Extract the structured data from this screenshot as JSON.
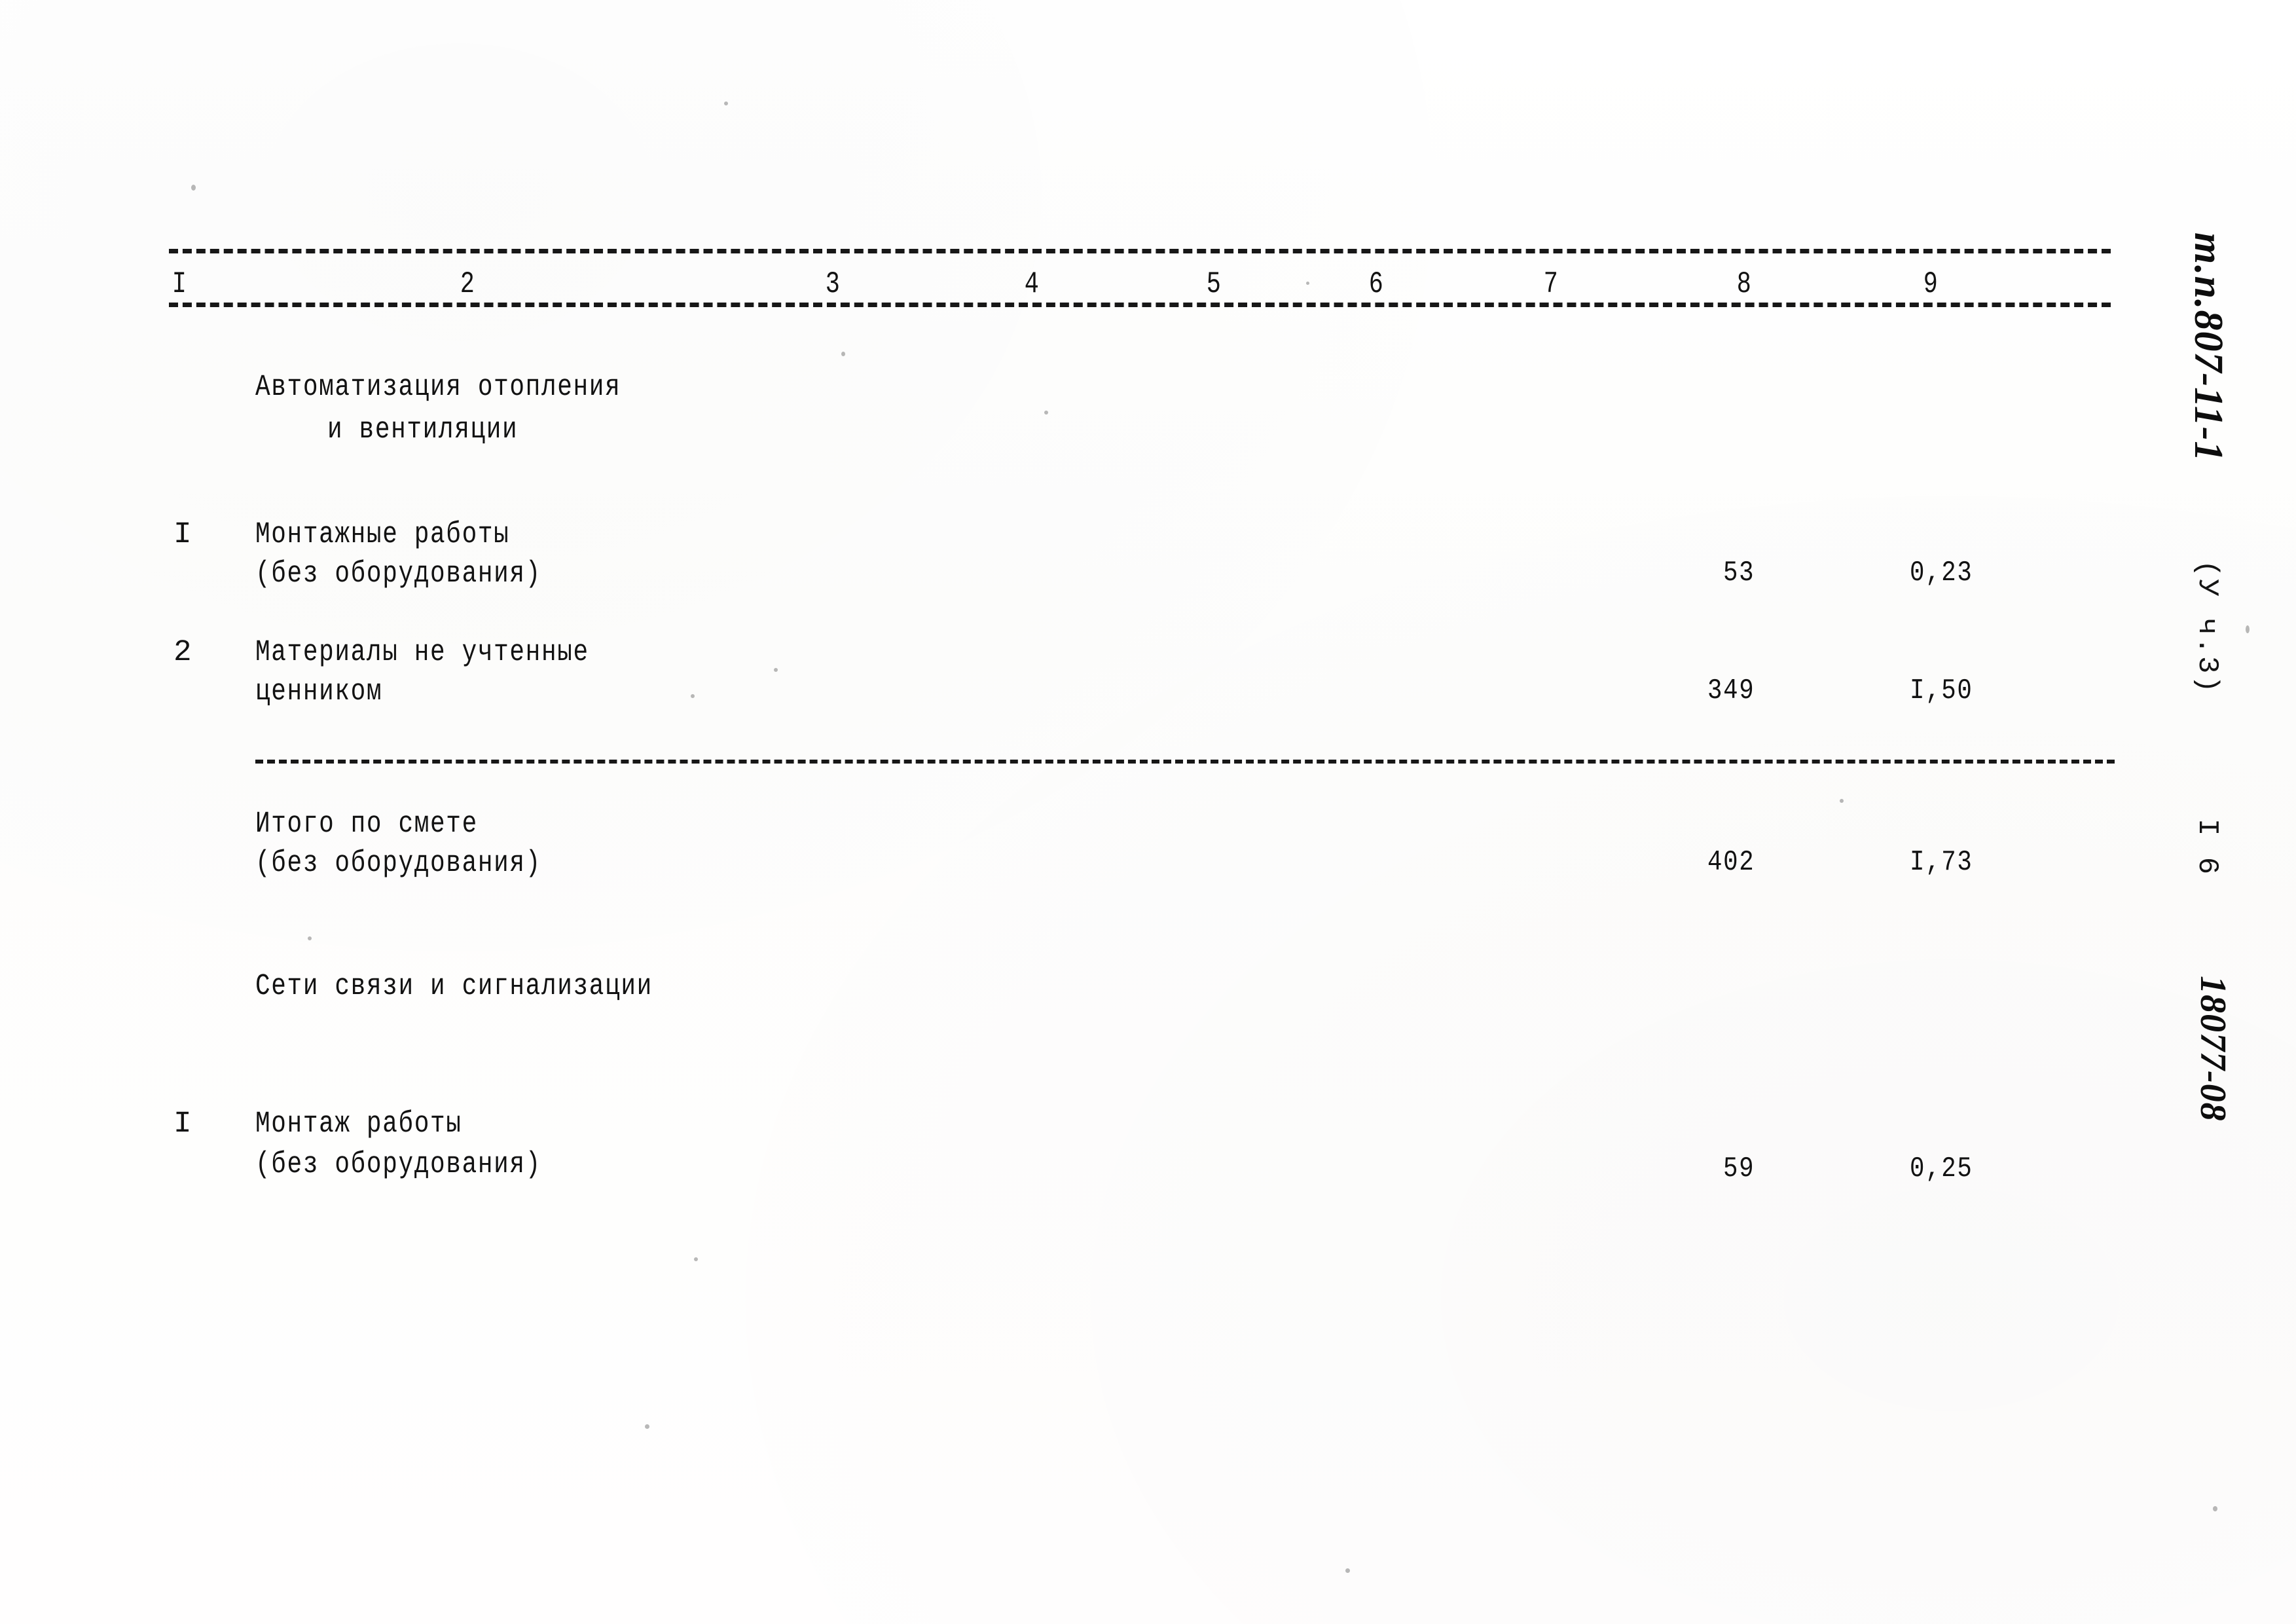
{
  "document": {
    "type": "scanned-estimate-table",
    "language": "ru"
  },
  "table": {
    "column_headers": [
      "I",
      "2",
      "3",
      "4",
      "5",
      "6",
      "7",
      "8",
      "9"
    ],
    "sections": [
      {
        "title": "Автоматизация отопления",
        "title_line2": "и вентиляции",
        "rows": [
          {
            "no": "I",
            "name_line1": "Монтажные работы",
            "name_line2": "(без оборудования)",
            "col8": "53",
            "col9": "0,23"
          },
          {
            "no": "2",
            "name_line1": "Материалы не учтенные",
            "name_line2": "ценником",
            "col8": "349",
            "col9": "I,50"
          }
        ],
        "total": {
          "name_line1": "Итого по смете",
          "name_line2": "(без оборудования)",
          "col8": "402",
          "col9": "I,73"
        }
      },
      {
        "title": "Сети связи и сигнализации",
        "title_line2": "",
        "rows": [
          {
            "no": "I",
            "name_line1": "Монтаж работы",
            "name_line2": "(без оборудования)",
            "col8": "59",
            "col9": "0,25"
          }
        ]
      }
    ]
  },
  "margin": {
    "project_code": "т.п.807-11-1",
    "part_note": "(У ч.3)",
    "page_number": "I 6",
    "archive_code": "18077-08"
  }
}
